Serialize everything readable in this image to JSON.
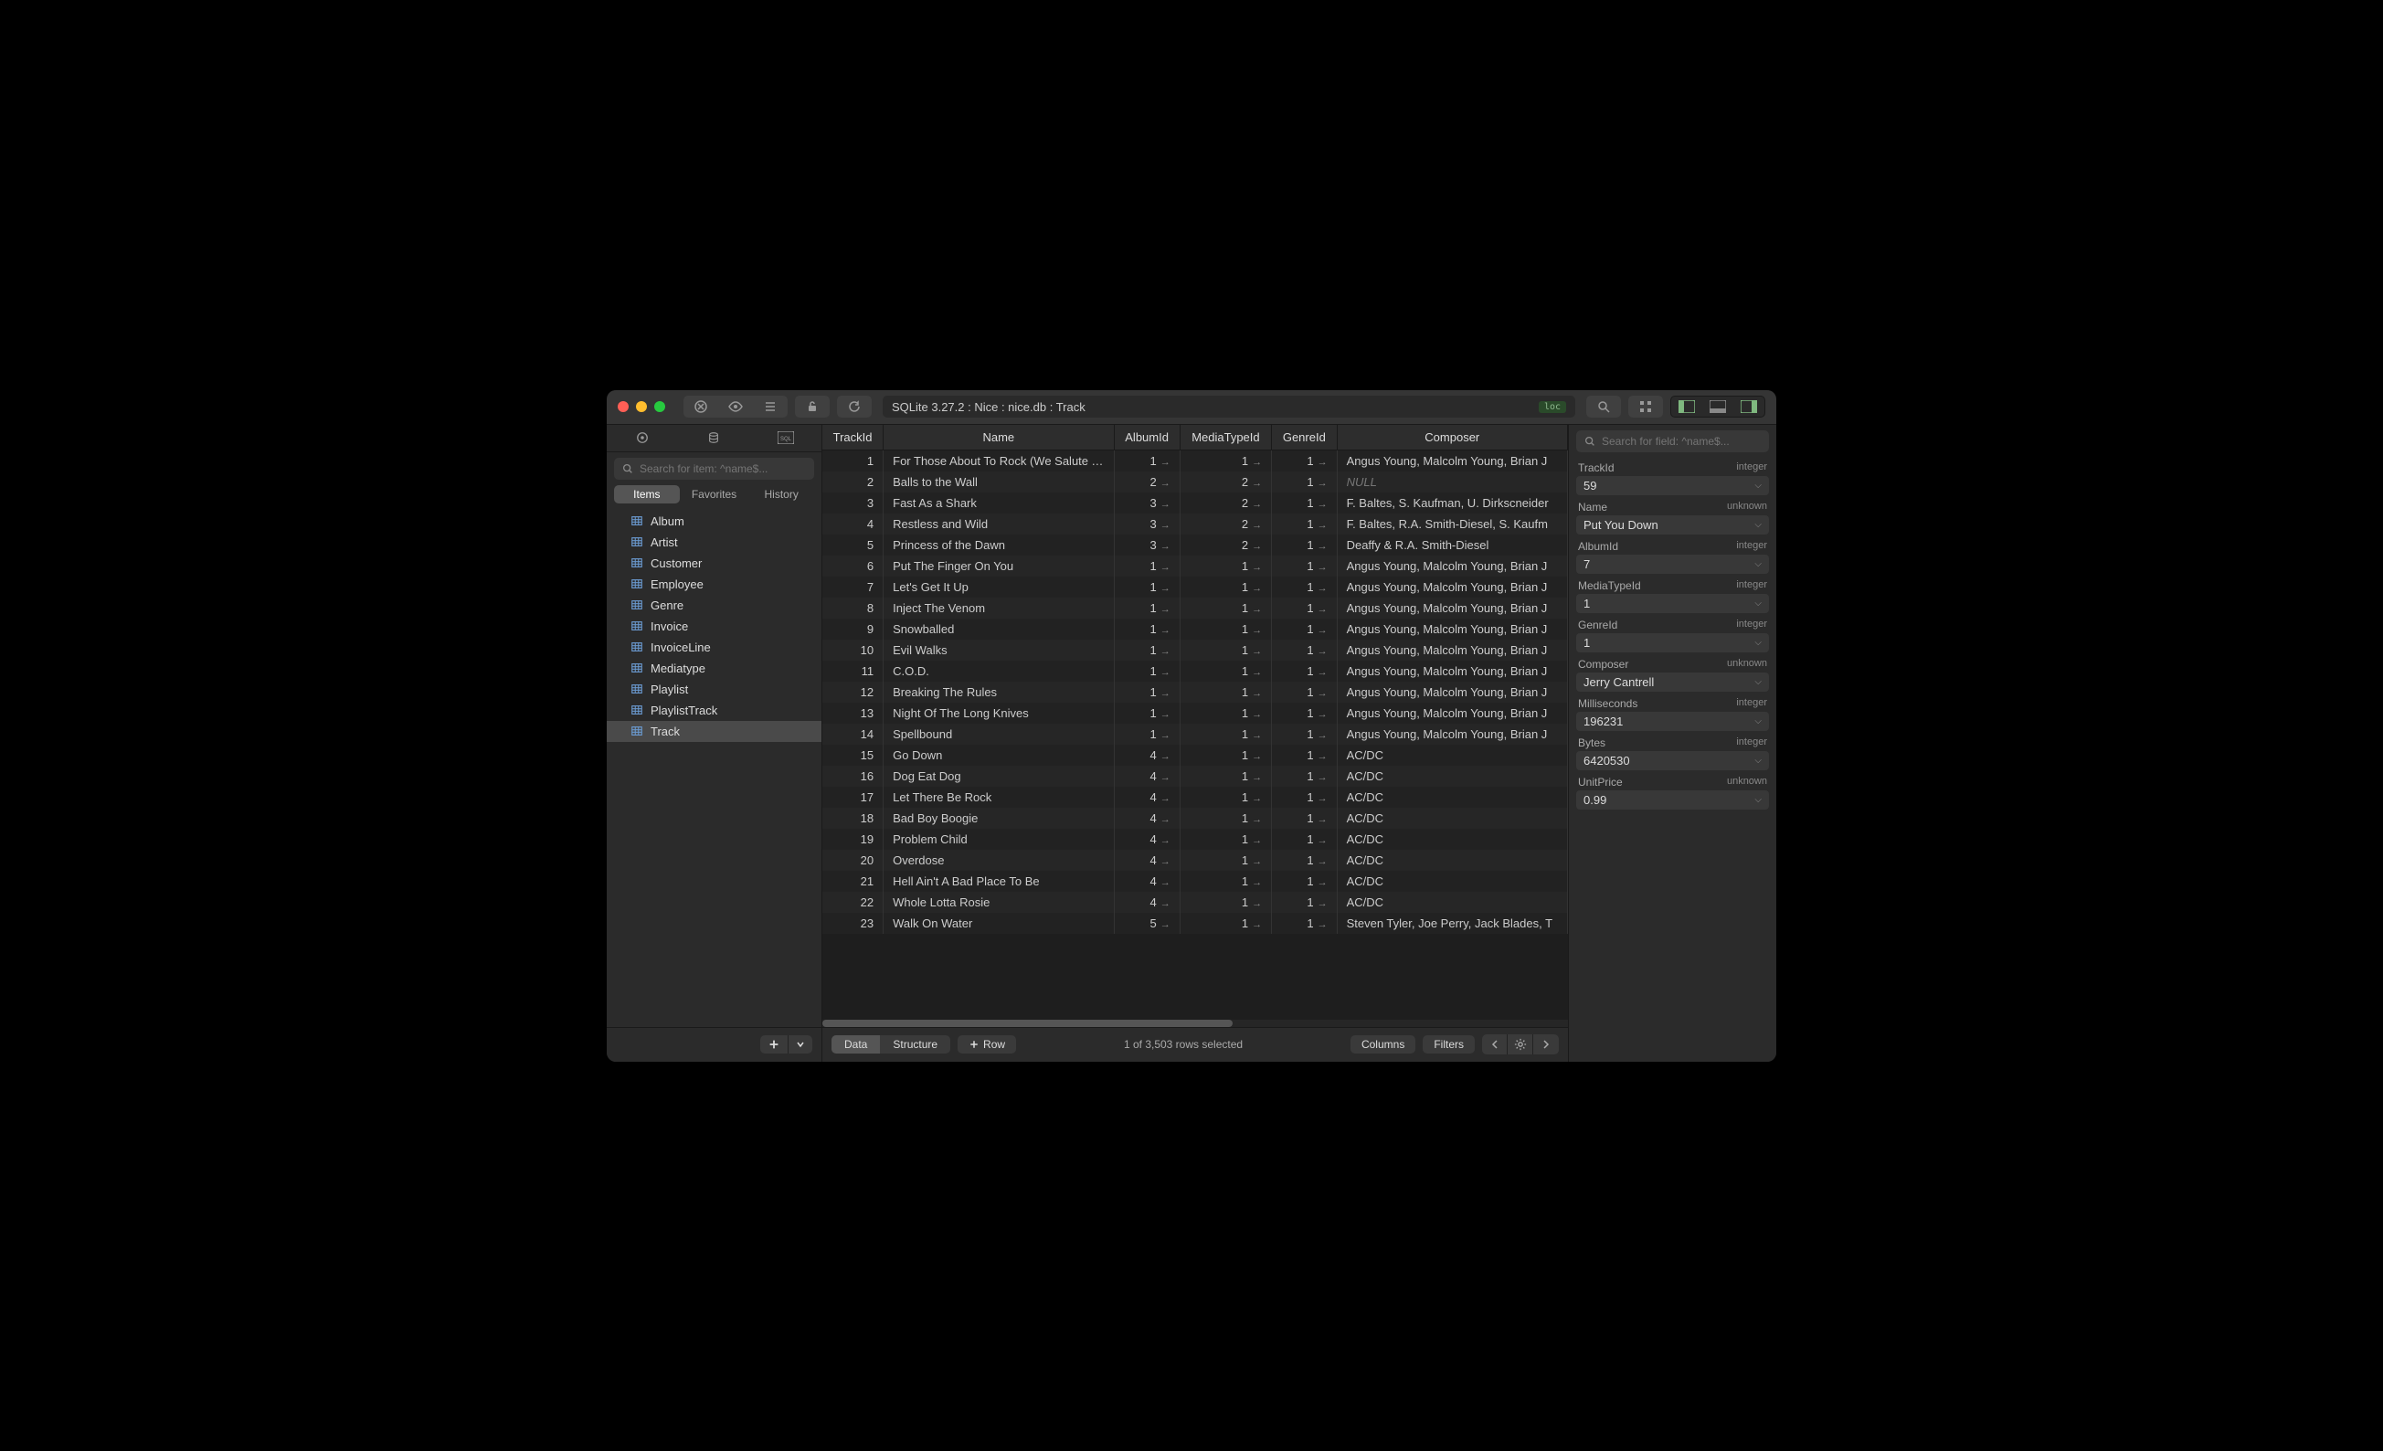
{
  "titlebar": {
    "path": "SQLite 3.27.2 : Nice : nice.db : Track",
    "loc_badge": "loc"
  },
  "sidebar": {
    "search_placeholder": "Search for item: ^name$...",
    "tabs": [
      "Items",
      "Favorites",
      "History"
    ],
    "active_tab": 0,
    "tables": [
      "Album",
      "Artist",
      "Customer",
      "Employee",
      "Genre",
      "Invoice",
      "InvoiceLine",
      "Mediatype",
      "Playlist",
      "PlaylistTrack",
      "Track"
    ],
    "selected_table": "Track"
  },
  "columns": [
    "TrackId",
    "Name",
    "AlbumId",
    "MediaTypeId",
    "GenreId",
    "Composer"
  ],
  "rows": [
    {
      "id": 1,
      "name": "For Those About To Rock (We Salute You)",
      "album": 1,
      "media": 1,
      "genre": 1,
      "composer": "Angus Young, Malcolm Young, Brian J"
    },
    {
      "id": 2,
      "name": "Balls to the Wall",
      "album": 2,
      "media": 2,
      "genre": 1,
      "composer": null
    },
    {
      "id": 3,
      "name": "Fast As a Shark",
      "album": 3,
      "media": 2,
      "genre": 1,
      "composer": "F. Baltes, S. Kaufman, U. Dirkscneider"
    },
    {
      "id": 4,
      "name": "Restless and Wild",
      "album": 3,
      "media": 2,
      "genre": 1,
      "composer": "F. Baltes, R.A. Smith-Diesel, S. Kaufm"
    },
    {
      "id": 5,
      "name": "Princess of the Dawn",
      "album": 3,
      "media": 2,
      "genre": 1,
      "composer": "Deaffy & R.A. Smith-Diesel"
    },
    {
      "id": 6,
      "name": "Put The Finger On You",
      "album": 1,
      "media": 1,
      "genre": 1,
      "composer": "Angus Young, Malcolm Young, Brian J"
    },
    {
      "id": 7,
      "name": "Let's Get It Up",
      "album": 1,
      "media": 1,
      "genre": 1,
      "composer": "Angus Young, Malcolm Young, Brian J"
    },
    {
      "id": 8,
      "name": "Inject The Venom",
      "album": 1,
      "media": 1,
      "genre": 1,
      "composer": "Angus Young, Malcolm Young, Brian J"
    },
    {
      "id": 9,
      "name": "Snowballed",
      "album": 1,
      "media": 1,
      "genre": 1,
      "composer": "Angus Young, Malcolm Young, Brian J"
    },
    {
      "id": 10,
      "name": "Evil Walks",
      "album": 1,
      "media": 1,
      "genre": 1,
      "composer": "Angus Young, Malcolm Young, Brian J"
    },
    {
      "id": 11,
      "name": "C.O.D.",
      "album": 1,
      "media": 1,
      "genre": 1,
      "composer": "Angus Young, Malcolm Young, Brian J"
    },
    {
      "id": 12,
      "name": "Breaking The Rules",
      "album": 1,
      "media": 1,
      "genre": 1,
      "composer": "Angus Young, Malcolm Young, Brian J"
    },
    {
      "id": 13,
      "name": "Night Of The Long Knives",
      "album": 1,
      "media": 1,
      "genre": 1,
      "composer": "Angus Young, Malcolm Young, Brian J"
    },
    {
      "id": 14,
      "name": "Spellbound",
      "album": 1,
      "media": 1,
      "genre": 1,
      "composer": "Angus Young, Malcolm Young, Brian J"
    },
    {
      "id": 15,
      "name": "Go Down",
      "album": 4,
      "media": 1,
      "genre": 1,
      "composer": "AC/DC"
    },
    {
      "id": 16,
      "name": "Dog Eat Dog",
      "album": 4,
      "media": 1,
      "genre": 1,
      "composer": "AC/DC"
    },
    {
      "id": 17,
      "name": "Let There Be Rock",
      "album": 4,
      "media": 1,
      "genre": 1,
      "composer": "AC/DC"
    },
    {
      "id": 18,
      "name": "Bad Boy Boogie",
      "album": 4,
      "media": 1,
      "genre": 1,
      "composer": "AC/DC"
    },
    {
      "id": 19,
      "name": "Problem Child",
      "album": 4,
      "media": 1,
      "genre": 1,
      "composer": "AC/DC"
    },
    {
      "id": 20,
      "name": "Overdose",
      "album": 4,
      "media": 1,
      "genre": 1,
      "composer": "AC/DC"
    },
    {
      "id": 21,
      "name": "Hell Ain't A Bad Place To Be",
      "album": 4,
      "media": 1,
      "genre": 1,
      "composer": "AC/DC"
    },
    {
      "id": 22,
      "name": "Whole Lotta Rosie",
      "album": 4,
      "media": 1,
      "genre": 1,
      "composer": "AC/DC"
    },
    {
      "id": 23,
      "name": "Walk On Water",
      "album": 5,
      "media": 1,
      "genre": 1,
      "composer": "Steven Tyler, Joe Perry, Jack Blades, T"
    }
  ],
  "footer": {
    "view_tabs": [
      "Data",
      "Structure"
    ],
    "active_view": 0,
    "row_btn": "Row",
    "status": "1 of 3,503 rows selected",
    "columns_btn": "Columns",
    "filters_btn": "Filters"
  },
  "inspector": {
    "search_placeholder": "Search for field: ^name$...",
    "fields": [
      {
        "name": "TrackId",
        "type": "integer",
        "value": "59"
      },
      {
        "name": "Name",
        "type": "unknown",
        "value": "Put You Down"
      },
      {
        "name": "AlbumId",
        "type": "integer",
        "value": "7"
      },
      {
        "name": "MediaTypeId",
        "type": "integer",
        "value": "1"
      },
      {
        "name": "GenreId",
        "type": "integer",
        "value": "1"
      },
      {
        "name": "Composer",
        "type": "unknown",
        "value": "Jerry Cantrell"
      },
      {
        "name": "Milliseconds",
        "type": "integer",
        "value": "196231"
      },
      {
        "name": "Bytes",
        "type": "integer",
        "value": "6420530"
      },
      {
        "name": "UnitPrice",
        "type": "unknown",
        "value": "0.99"
      }
    ]
  },
  "null_text": "NULL"
}
